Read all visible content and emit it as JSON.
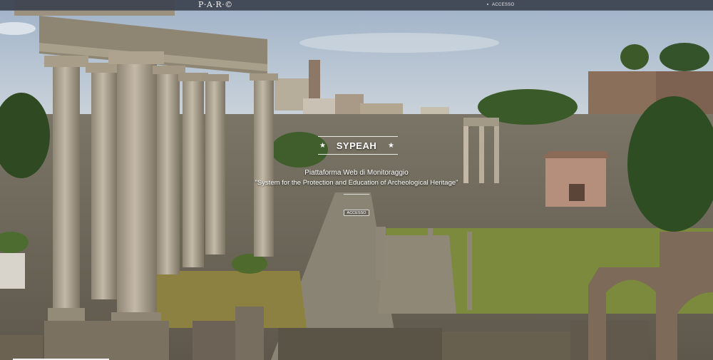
{
  "header": {
    "logo_text": "P·A·R·©",
    "nav_login": "ACCESSO"
  },
  "hero": {
    "title": "SYPEAH",
    "star_glyph": "★",
    "subtitle": "Piattaforma Web di Monitoraggio",
    "tagline": "\"System for the Protection and Education of Archeological Heritage\"",
    "cta_label": "ACCESSO"
  },
  "background": {
    "scene": "roman-forum-photo",
    "sky_color": "#b9c8da",
    "stone_color": "#a69b88",
    "grass_color": "#8a8f3e",
    "tree_color": "#2f4a22"
  }
}
